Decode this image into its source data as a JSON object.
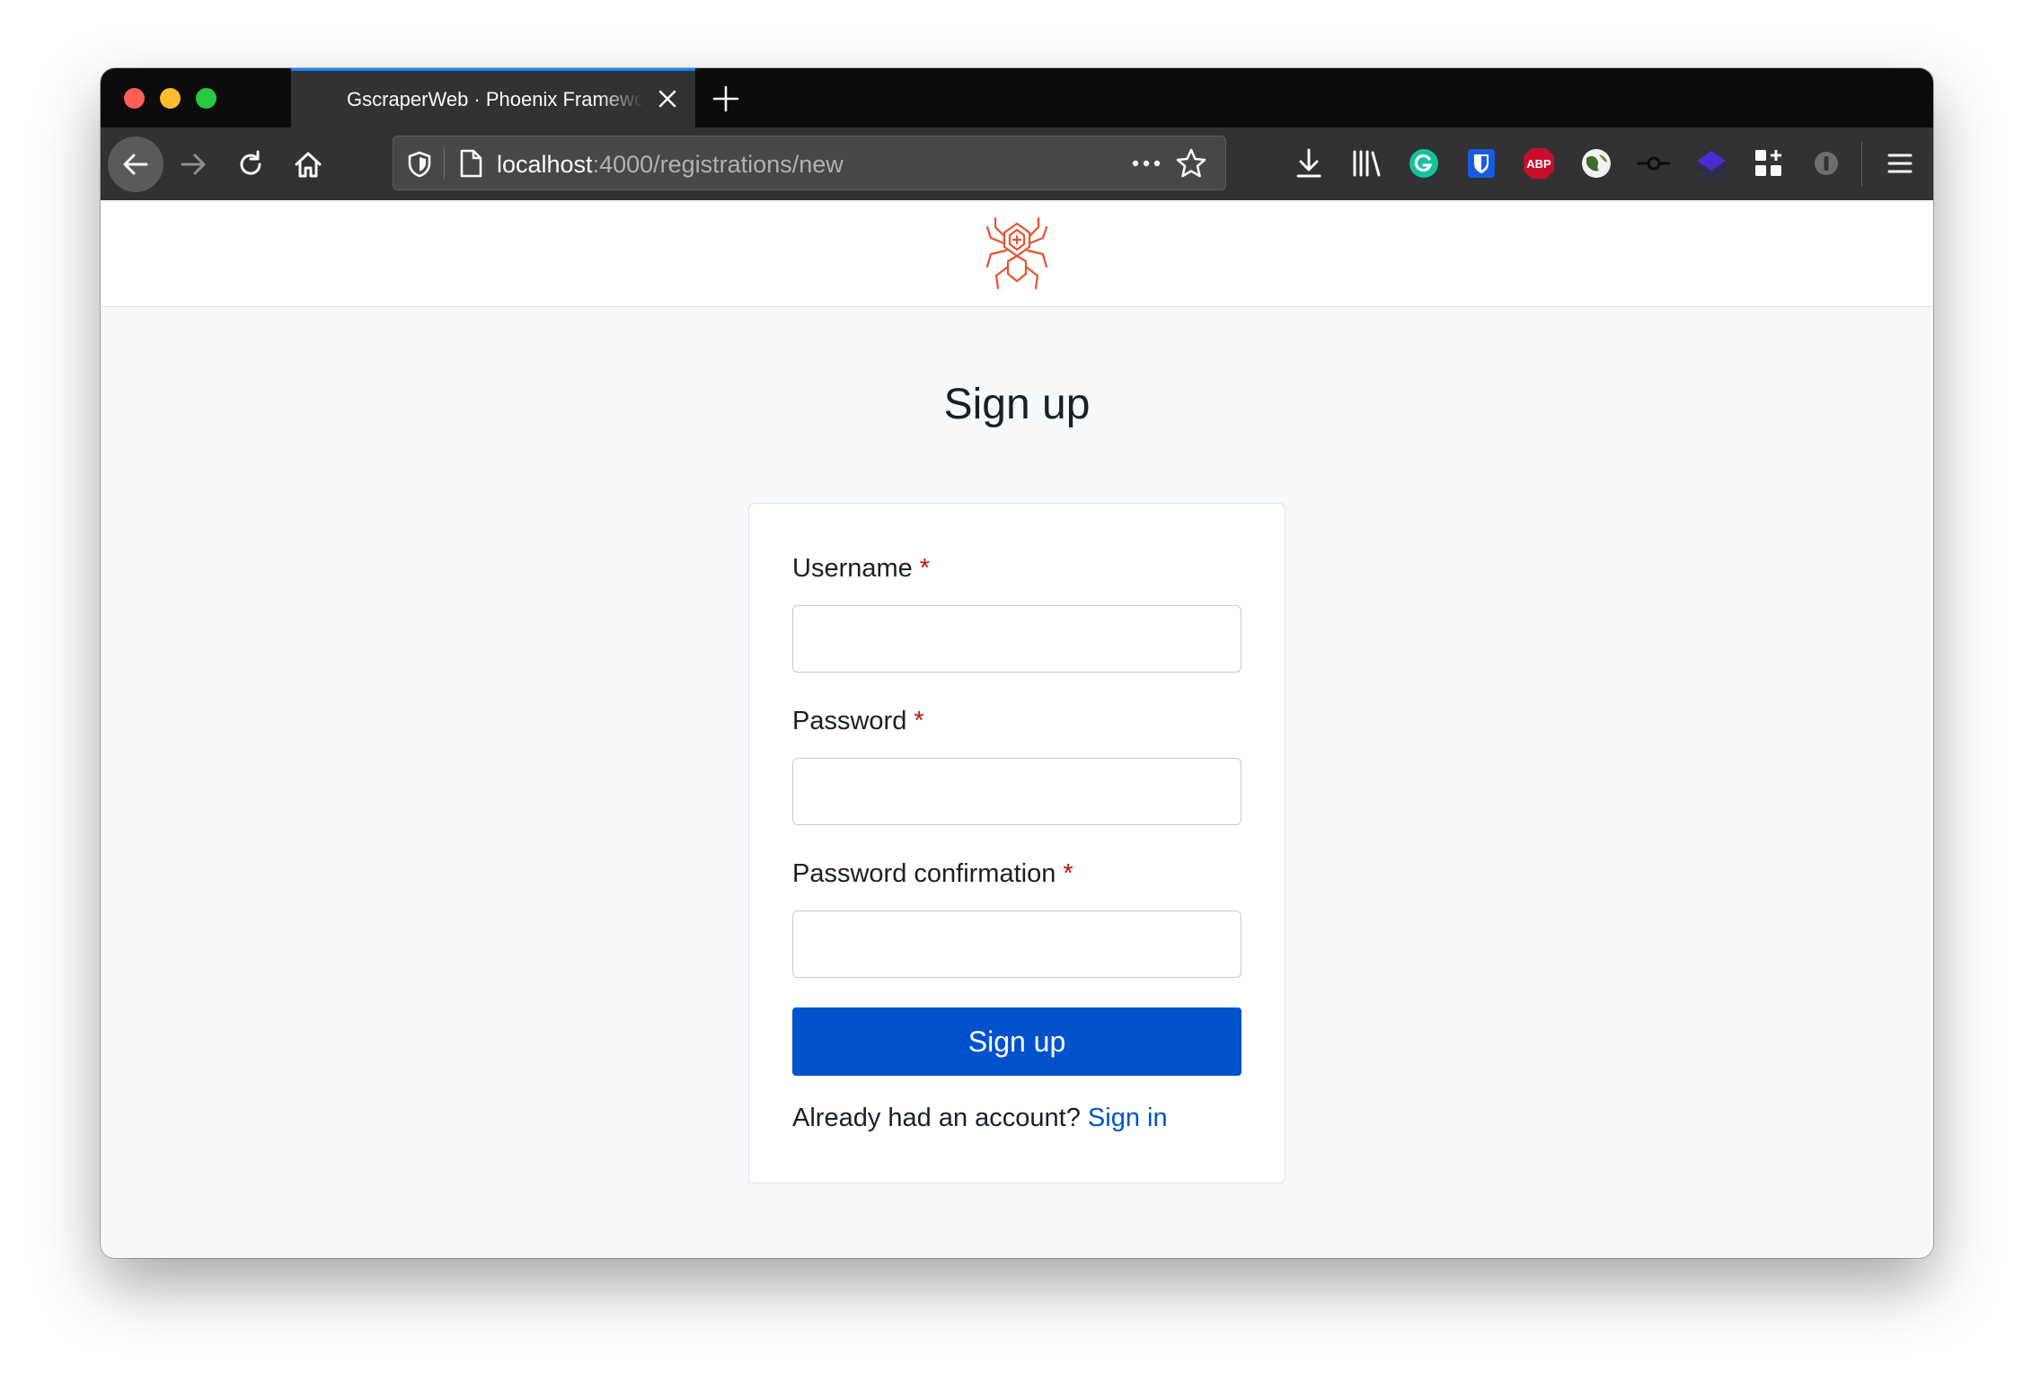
{
  "browser": {
    "tab_title": "GscraperWeb · Phoenix Framework",
    "url_host": "localhost",
    "url_path": ":4000/registrations/new"
  },
  "toolbar_icons": [
    "download-icon",
    "library-icon",
    "grammarly-icon",
    "bitwarden-icon",
    "adblock-plus-icon",
    "globe-extension-icon",
    "commit-icon",
    "layers-extension-icon",
    "extensions-grid-icon",
    "info-extension-icon",
    "hamburger-menu-icon"
  ],
  "extensions": {
    "abp_label": "ABP"
  },
  "page": {
    "title": "Sign up"
  },
  "form": {
    "username_label": "Username",
    "password_label": "Password",
    "password_confirmation_label": "Password confirmation",
    "required_mark": "*",
    "username_value": "",
    "password_value": "",
    "password_confirmation_value": "",
    "submit_label": "Sign up",
    "signin_prompt": "Already had an account?",
    "signin_link": "Sign in"
  },
  "colors": {
    "accent": "#0052cc",
    "required": "#c0120a",
    "logo": "#e8512d"
  }
}
